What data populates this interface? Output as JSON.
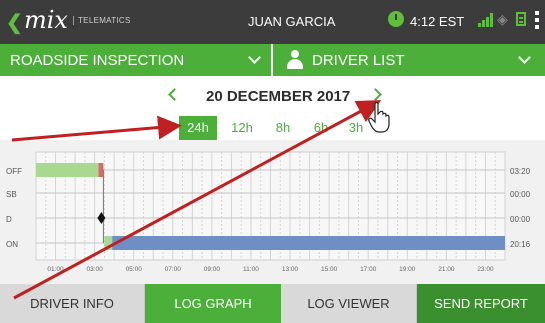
{
  "statusbar": {
    "logo": "mix",
    "telematics": "TELEMATICS",
    "user": "JUAN GARCIA",
    "time": "4:12 EST",
    "icons": [
      "back-chevron-icon",
      "clock-icon",
      "signal-icon",
      "wifi-icon",
      "document-icon",
      "overflow-menu-icon"
    ]
  },
  "nav": {
    "left_label": "ROADSIDE INSPECTION",
    "right_label": "DRIVER LIST"
  },
  "date": {
    "label": "20 DECEMBER 2017"
  },
  "range_tabs": [
    {
      "label": "24h",
      "active": true
    },
    {
      "label": "12h",
      "active": false
    },
    {
      "label": "8h",
      "active": false
    },
    {
      "label": "6h",
      "active": false
    },
    {
      "label": "3h",
      "active": false
    }
  ],
  "colors": {
    "green": "#4caf3a",
    "dark_green": "#3a8f2e",
    "status_bar": "#3c3c3c",
    "off_duty": "#a9d890",
    "off_duty_edge": "#d96a6a",
    "on_duty": "#6f8fc4",
    "annotation_arrow": "#c0201f"
  },
  "chart_data": {
    "type": "gantt",
    "rows": [
      "OFF",
      "SB",
      "D",
      "ON"
    ],
    "x_ticks": [
      "01:00",
      "03:00",
      "05:00",
      "07:00",
      "09:00",
      "11:00",
      "13:00",
      "15:00",
      "17:00",
      "19:00",
      "21:00",
      "23:00"
    ],
    "xlim_hours": [
      0,
      24
    ],
    "totals": {
      "OFF": "03:20",
      "SB": "00:00",
      "D": "00:00",
      "ON": "20:16"
    },
    "segments": [
      {
        "row": "OFF",
        "start_h": 0,
        "end_h": 3.2,
        "color": "#a9d890"
      },
      {
        "row": "OFF",
        "start_h": 3.2,
        "end_h": 3.45,
        "color": "#d96a6a"
      },
      {
        "row": "ON",
        "start_h": 3.5,
        "end_h": 3.9,
        "color": "#a9d890"
      },
      {
        "row": "ON",
        "start_h": 3.9,
        "end_h": 24,
        "color": "#6f8fc4"
      }
    ],
    "markers": [
      {
        "row": "D",
        "at_h": 3.5,
        "shape": "diamond"
      }
    ],
    "grid": true
  },
  "bottom_tabs": [
    {
      "label": "DRIVER INFO"
    },
    {
      "label": "LOG GRAPH"
    },
    {
      "label": "LOG VIEWER"
    },
    {
      "label": "SEND REPORT"
    }
  ]
}
